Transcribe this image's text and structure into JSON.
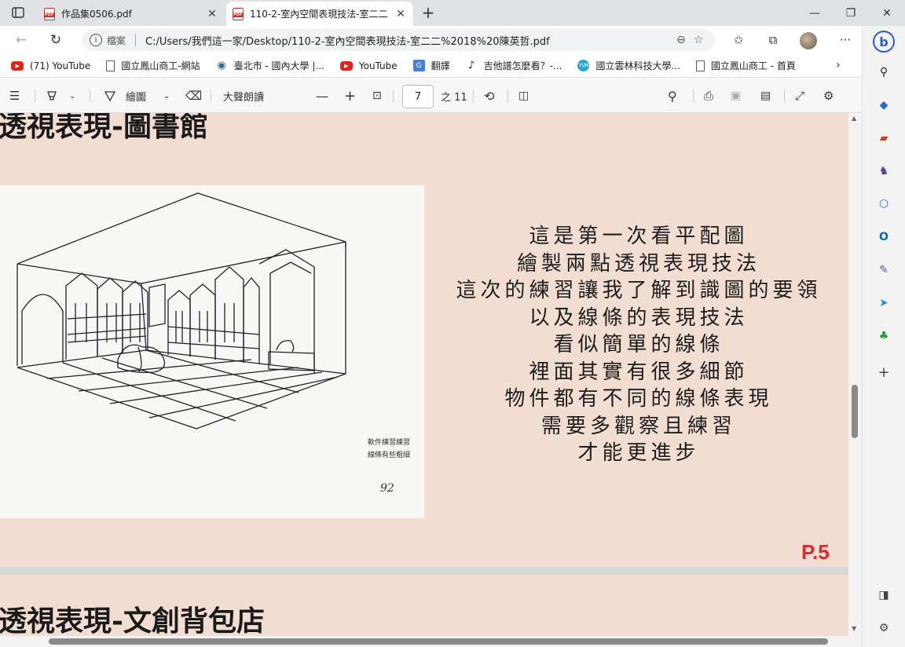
{
  "tabs": [
    {
      "title": "作品集0506.pdf",
      "active": false
    },
    {
      "title": "110-2-室內空間表現技法-室二二",
      "active": true
    }
  ],
  "address": {
    "label": "檔案",
    "url": "C:/Users/我們這一家/Desktop/110-2-室內空間表現技法-室二二%2018%20陳英哲.pdf"
  },
  "bookmarks": [
    {
      "label": "(71) YouTube",
      "icon": "youtube-icon"
    },
    {
      "label": "國立鳳山商工-網站",
      "icon": "page-icon"
    },
    {
      "label": "臺北市 - 國內大學 |...",
      "icon": "globe-icon"
    },
    {
      "label": "YouTube",
      "icon": "youtube-icon"
    },
    {
      "label": "翻譯",
      "icon": "translate-icon"
    },
    {
      "label": "吉他譜怎麼看？-...",
      "icon": "guitar-icon"
    },
    {
      "label": "國立雲林科技大學...",
      "icon": "yuntech-icon"
    },
    {
      "label": "國立鳳山商工 - 首頁",
      "icon": "page-icon"
    }
  ],
  "pdf_toolbar": {
    "draw_label": "繪圖",
    "read_aloud_label": "大聲朗讀",
    "current_page": "7",
    "total_pages": "之 11"
  },
  "document": {
    "heading1": "透視表現-圖書館",
    "poem_lines": [
      "這是第一次看平配圖",
      "繪製兩點透視表現技法",
      "這次的練習讓我了解到識圖的要領",
      "以及線條的表現技法",
      "看似簡單的線條",
      "裡面其實有很多細節",
      "物件都有不同的線條表現",
      "需要多觀察且練習",
      "才能更進步"
    ],
    "page_number": "P.5",
    "heading2": "透視表現-文創背包店",
    "sketch_note_1": "軟件練習練習",
    "sketch_note_2": "線條有些粗細",
    "sketch_grade": "92"
  },
  "colors": {
    "page_bg": "#f2ddd2",
    "page_number": "#e0282a"
  }
}
